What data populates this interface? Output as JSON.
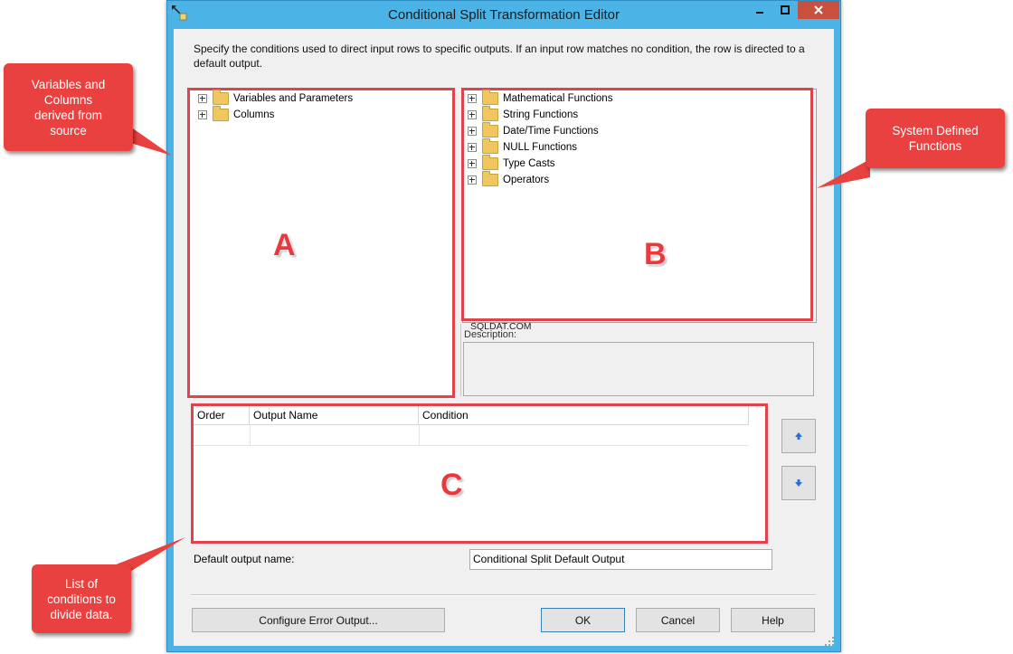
{
  "window": {
    "title": "Conditional Split Transformation Editor"
  },
  "instructions": "Specify the conditions used to direct input rows to specific outputs. If an input row matches no condition, the row is directed to a default output.",
  "left_tree": {
    "items": [
      "Variables and Parameters",
      "Columns"
    ]
  },
  "right_tree": {
    "items": [
      "Mathematical Functions",
      "String Functions",
      "Date/Time Functions",
      "NULL Functions",
      "Type Casts",
      "Operators"
    ]
  },
  "watermark": "SQLDAT.COM",
  "description_label": "Description:",
  "grid": {
    "columns": [
      "Order",
      "Output Name",
      "Condition"
    ]
  },
  "default_output": {
    "label": "Default output name:",
    "value": "Conditional Split Default Output"
  },
  "buttons": {
    "configure": "Configure Error Output...",
    "ok": "OK",
    "cancel": "Cancel",
    "help": "Help"
  },
  "annotations": {
    "a": "A",
    "b": "B",
    "c": "C",
    "callout_left_top": "Variables and Columns derived from source",
    "callout_right": "System Defined Functions",
    "callout_left_bottom": "List of conditions to divide data."
  },
  "colors": {
    "accent_red": "#e9413f",
    "title_bar": "#4bb3e6"
  }
}
